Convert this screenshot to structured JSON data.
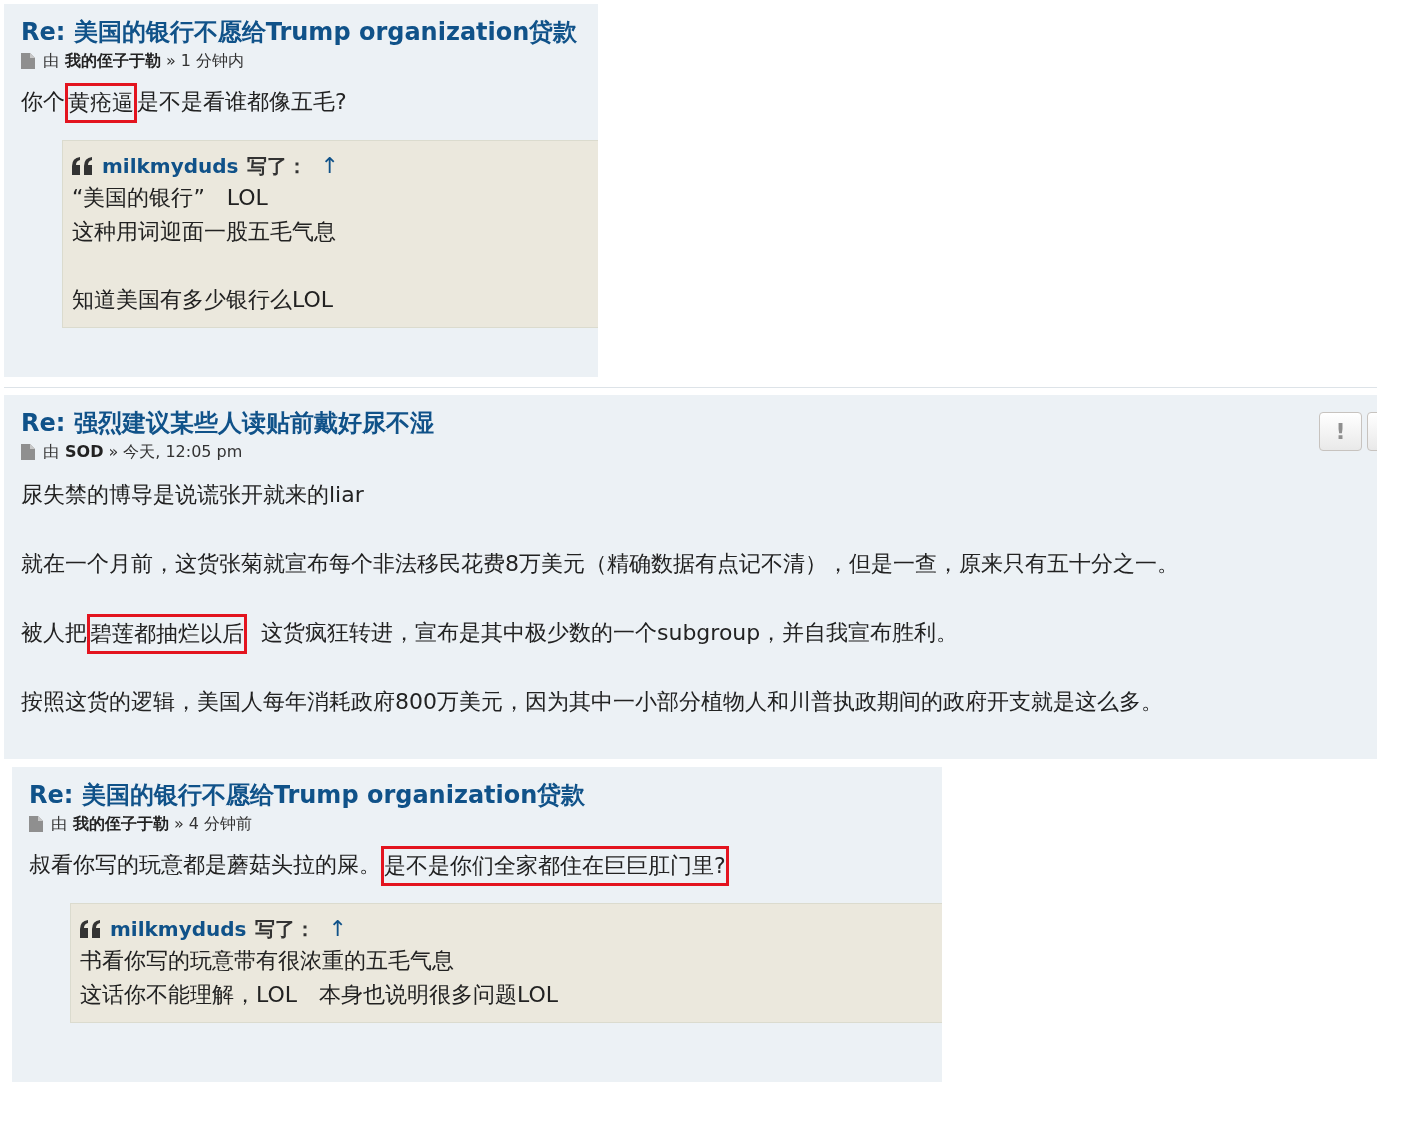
{
  "posts": [
    {
      "title": "Re: 美国的银行不愿给Trump organization贷款",
      "by": "由",
      "author": "我的侄子于勒",
      "sep": "»",
      "time": "1 分钟内",
      "paragraphs": [
        [
          {
            "text": "你个",
            "highlighted": false
          },
          {
            "text": "黄疮逼",
            "highlighted": true
          },
          {
            "text": "是不是看谁都像五毛?",
            "highlighted": false
          }
        ]
      ],
      "quote": {
        "author": "milkmyduds",
        "wrote": "写了：",
        "up": "↑",
        "blocks": [
          [
            "“美国的银行”　LOL",
            "这种用词迎面一股五毛气息"
          ],
          [
            "知道美国有多少银行么LOL"
          ]
        ]
      }
    },
    {
      "title": "Re: 强烈建议某些人读贴前戴好尿不湿",
      "by": "由",
      "author": "SOD",
      "sep": "»",
      "time": "今天, 12:05 pm",
      "buttons": [
        {
          "kind": "text",
          "label": "!"
        },
        {
          "kind": "clipped"
        }
      ],
      "paragraphs": [
        [
          {
            "text": "尿失禁的博导是说谎张开就来的liar",
            "highlighted": false
          }
        ],
        [
          {
            "text": "就在一个月前，这货张菊就宣布每个非法移民花费8万美元（精确数据有点记不清），但是一查，原来只有五十分之一。",
            "highlighted": false
          }
        ],
        [
          {
            "text": "被人把",
            "highlighted": false
          },
          {
            "text": "碧莲都抽烂以后",
            "highlighted": true
          },
          {
            "text": "  这货疯狂转进，宣布是其中极少数的一个subgroup，并自我宣布胜利。",
            "highlighted": false
          }
        ],
        [
          {
            "text": "按照这货的逻辑，美国人每年消耗政府800万美元，因为其中一小部分植物人和川普执政期间的政府开支就是这么多。",
            "highlighted": false
          }
        ]
      ]
    },
    {
      "title": "Re: 美国的银行不愿给Trump organization贷款",
      "by": "由",
      "author": "我的侄子于勒",
      "sep": "»",
      "time": "4 分钟前",
      "paragraphs": [
        [
          {
            "text": "叔看你写的玩意都是蘑菇头拉的屎。",
            "highlighted": false
          },
          {
            "text": "是不是你们全家都住在巨巨肛门里?",
            "highlighted": true
          }
        ]
      ],
      "quote": {
        "author": "milkmyduds",
        "wrote": "写了：",
        "up": "↑",
        "blocks": [
          [
            "书看你写的玩意带有很浓重的五毛气息",
            "这话你不能理解，LOL　本身也说明很多问题LOL"
          ]
        ]
      }
    }
  ]
}
